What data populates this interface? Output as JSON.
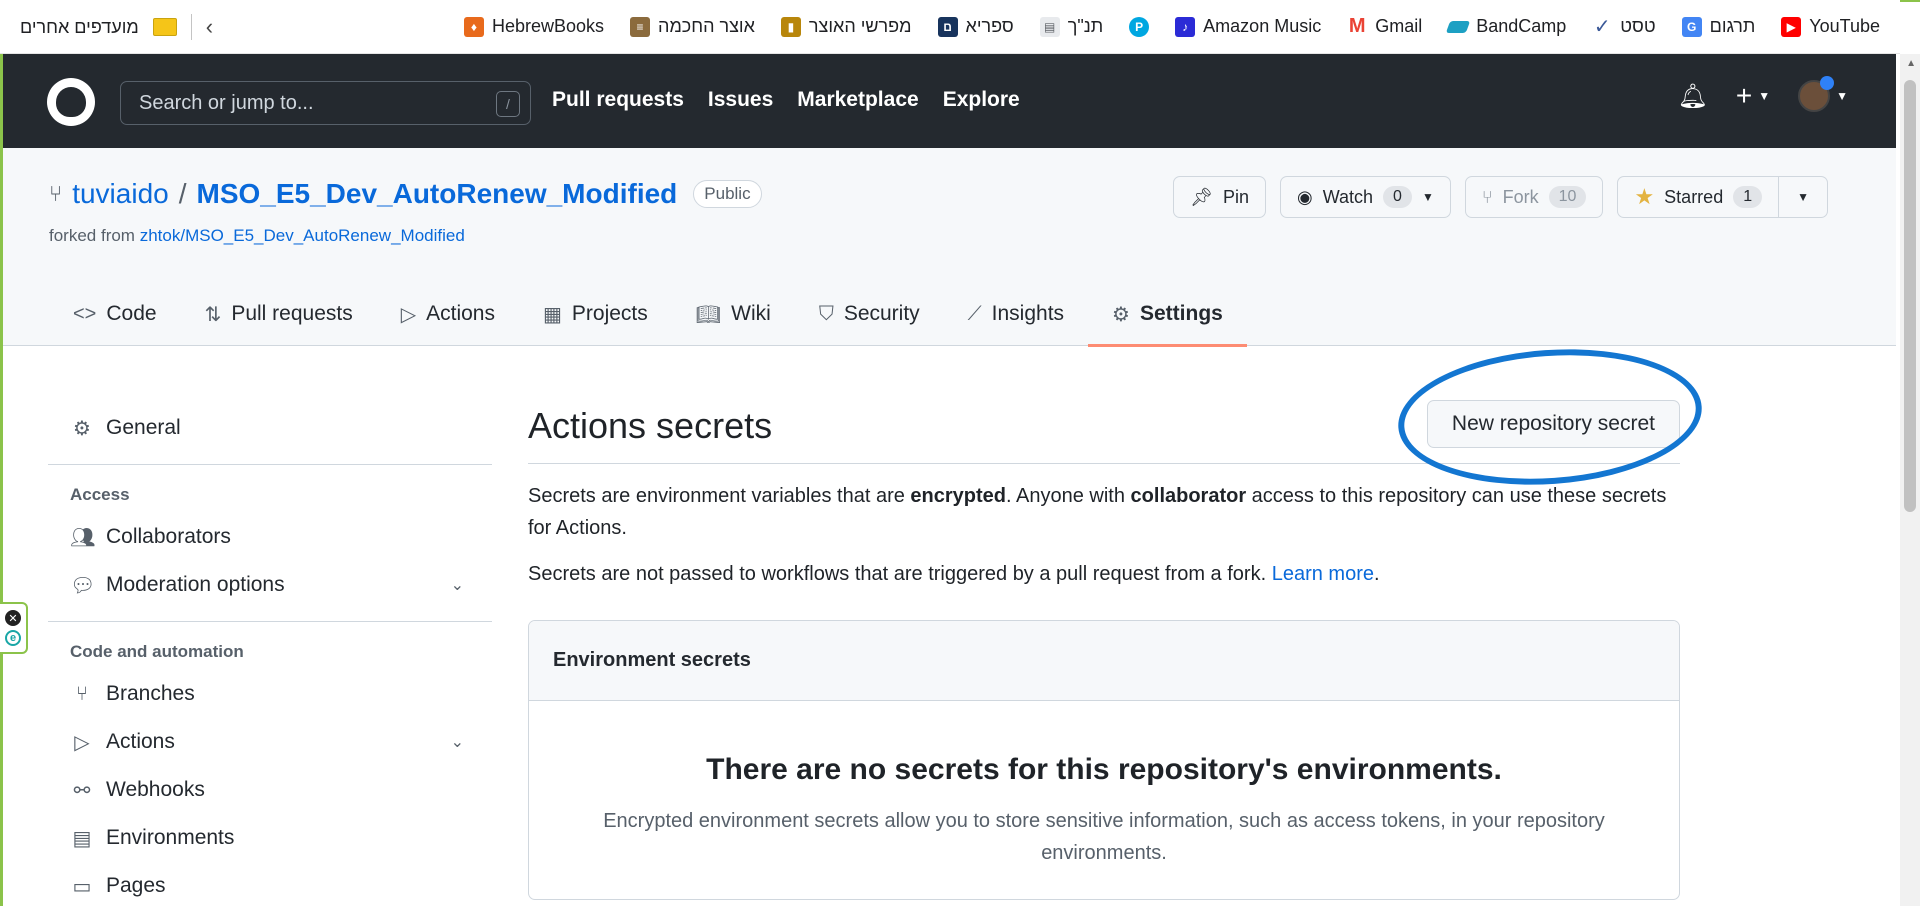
{
  "bookmarks": {
    "items": [
      {
        "label": "YouTube",
        "icon": "youtube-icon",
        "color": "#ff0000"
      },
      {
        "label": "תרגום",
        "icon": "translate-icon",
        "color": "#4285f4"
      },
      {
        "label": "טסט",
        "icon": "check-icon",
        "color": "#3b5998"
      },
      {
        "label": "BandCamp",
        "icon": "bandcamp-icon",
        "color": "#1da0c3"
      },
      {
        "label": "Gmail",
        "icon": "gmail-icon",
        "color": "#ea4335"
      },
      {
        "label": "Amazon Music",
        "icon": "amazon-music-icon",
        "color": "#2b2bd6"
      },
      {
        "label": "",
        "icon": "p-icon",
        "color": "#00a7e1"
      },
      {
        "label": "תנ\"ך",
        "icon": "document-icon",
        "color": "#9aa0a6"
      },
      {
        "label": "ספריא",
        "icon": "sefaria-icon",
        "color": "#18345d"
      },
      {
        "label": "מפרשי האוצר",
        "icon": "book-icon",
        "color": "#b8860b"
      },
      {
        "label": "אוצר החכמה",
        "icon": "scroll-icon",
        "color": "#8b6b3d"
      },
      {
        "label": "HebrewBooks",
        "icon": "hebrewbooks-icon",
        "color": "#e86a1c"
      }
    ],
    "others_label": "מועדפים אחרים"
  },
  "header": {
    "search_placeholder": "Search or jump to...",
    "search_shortcut": "/",
    "nav": [
      "Pull requests",
      "Issues",
      "Marketplace",
      "Explore"
    ]
  },
  "repo": {
    "owner": "tuviaido",
    "separator": "/",
    "name": "MSO_E5_Dev_AutoRenew_Modified",
    "visibility": "Public",
    "forked_prefix": "forked from",
    "forked_from": "zhtok/MSO_E5_Dev_AutoRenew_Modified",
    "pin_label": "Pin",
    "watch_label": "Watch",
    "watch_count": "0",
    "fork_label": "Fork",
    "fork_count": "10",
    "starred_label": "Starred",
    "star_count": "1"
  },
  "tabs": [
    {
      "label": "Code",
      "icon": "code-icon"
    },
    {
      "label": "Pull requests",
      "icon": "pull-request-icon"
    },
    {
      "label": "Actions",
      "icon": "play-icon"
    },
    {
      "label": "Projects",
      "icon": "table-icon"
    },
    {
      "label": "Wiki",
      "icon": "book-icon"
    },
    {
      "label": "Security",
      "icon": "shield-icon"
    },
    {
      "label": "Insights",
      "icon": "graph-icon"
    },
    {
      "label": "Settings",
      "icon": "gear-icon",
      "active": true
    }
  ],
  "sidebar": {
    "general": "General",
    "access_heading": "Access",
    "collaborators": "Collaborators",
    "moderation": "Moderation options",
    "code_heading": "Code and automation",
    "branches": "Branches",
    "actions": "Actions",
    "webhooks": "Webhooks",
    "environments": "Environments",
    "pages": "Pages"
  },
  "main": {
    "title": "Actions secrets",
    "new_secret_button": "New repository secret",
    "p1_a": "Secrets are environment variables that are ",
    "p1_b": "encrypted",
    "p1_c": ". Anyone with ",
    "p1_d": "collaborator",
    "p1_e": " access to this repository can use these secrets for Actions.",
    "p2_a": "Secrets are not passed to workflows that are triggered by a pull request from a fork. ",
    "p2_link": "Learn more",
    "p2_end": ".",
    "env_heading": "Environment secrets",
    "env_empty_title": "There are no secrets for this repository's environments.",
    "env_empty_desc": "Encrypted environment secrets allow you to store sensitive information, such as access tokens, in your repository environments."
  },
  "colors": {
    "accent": "#0969da",
    "header_bg": "#24292f",
    "active_tab": "#fd8c73",
    "annotation": "#1376d1"
  }
}
